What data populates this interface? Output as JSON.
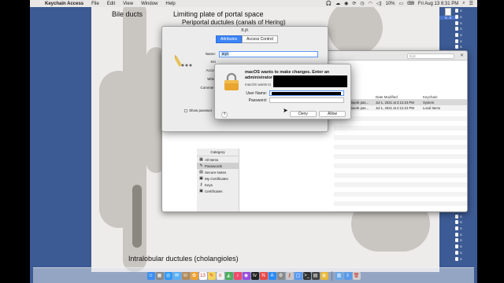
{
  "menubar": {
    "app": "Keychain Access",
    "items": [
      "File",
      "Edit",
      "View",
      "Window",
      "Help"
    ],
    "battery": "10%",
    "datetime": "Fri Aug 13  8:31 PM"
  },
  "wallpaper": {
    "labels": {
      "bile_ducts": "Bile ducts",
      "limiting_plate": "Limiting plate of portal space",
      "periportal": "Periportal ductules (canals of Hering)",
      "intralobular": "Intralobular ductules (cholangioles)"
    }
  },
  "desktop": {
    "top_file": "9...ff",
    "right_files": [
      "S",
      "S",
      "S",
      "S",
      "S",
      "S",
      "S",
      "S",
      "S",
      "S",
      "S",
      "S",
      "S",
      "S",
      "S",
      "S",
      "S",
      "S",
      "S",
      "S",
      "S",
      "S",
      "S",
      "S",
      "S",
      "S",
      "S",
      "S",
      "S",
      "S",
      "S",
      "S",
      "S",
      "S",
      "S",
      "S",
      "S",
      "S",
      "S",
      "S",
      "S",
      "S"
    ]
  },
  "keychain": {
    "search_placeholder": "B.jK",
    "columns": {
      "kind": "Kind",
      "date": "Date Modified",
      "keychain": "Keychain"
    },
    "rows": [
      {
        "kind": "AirPort network pas...",
        "date": "Jul 1, 2021 at 2:12:23 PM",
        "keychain": "System"
      },
      {
        "kind": "AirPort network pas...",
        "date": "Jul 1, 2021 at 2:12:22 PM",
        "keychain": "Local Items"
      }
    ],
    "category": {
      "header": "Category",
      "items": [
        {
          "label": "All Items",
          "icon": "all-items-icon",
          "glyph": "▦"
        },
        {
          "label": "Passwords",
          "icon": "passwords-icon",
          "glyph": "✎"
        },
        {
          "label": "Secure Notes",
          "icon": "secure-notes-icon",
          "glyph": "▤"
        },
        {
          "label": "My Certificates",
          "icon": "my-certificates-icon",
          "glyph": "▣"
        },
        {
          "label": "Keys",
          "icon": "keys-icon",
          "glyph": "⚷"
        },
        {
          "label": "Certificates",
          "icon": "certificates-icon",
          "glyph": "▣"
        }
      ]
    }
  },
  "attributes": {
    "title": "B.jK",
    "tabs": [
      "Attributes",
      "Access Control"
    ],
    "labels": {
      "name": "Name:",
      "kind": "Kin",
      "account": "Accou",
      "where": "Wher",
      "comments": "Comment"
    },
    "name_value": "B.jK",
    "show_password": "Show passwor"
  },
  "auth": {
    "title": "macOS wants to make changes. Enter an administrator",
    "subtitle": "macOS wants to",
    "username_label": "User Name:",
    "password_label": "Password:",
    "help": "?",
    "deny": "Deny",
    "allow": "Allow"
  },
  "dock": {
    "icons": [
      "finder",
      "launchpad",
      "safari",
      "mail",
      "contacts",
      "photos",
      "calendar",
      "notes",
      "reminders",
      "maps",
      "music",
      "podcasts",
      "tv",
      "news",
      "app-store",
      "system-preferences",
      "keychain",
      "preview",
      "terminal",
      "activity",
      "chrome",
      "finder-folder",
      "downloads",
      "trash"
    ],
    "colors": [
      "#3d8ef0",
      "#8a8a8a",
      "#2e9af7",
      "#5ab0f5",
      "#b08a5a",
      "#f0a030",
      "#ffffff",
      "#f5d35c",
      "#f0f0f0",
      "#4cae5a",
      "#f04a6a",
      "#9b4de0",
      "#222222",
      "#e84a4a",
      "#2a8af5",
      "#8a8a8a",
      "#c9c9c9",
      "#5a9af0",
      "#333333",
      "#444444",
      "#e8b83a",
      "#6aa8e8",
      "#5a9ae8",
      "#cfcfcf"
    ],
    "glyphs": [
      "☺",
      "▦",
      "◎",
      "✉",
      "☏",
      "✿",
      "13",
      "✎",
      "≡",
      "◭",
      "♪",
      "◉",
      "tv",
      "N",
      "A",
      "⚙",
      "⚷",
      "▢",
      ">_",
      "▤",
      "◍",
      "▥",
      "⇩",
      "🗑"
    ]
  }
}
